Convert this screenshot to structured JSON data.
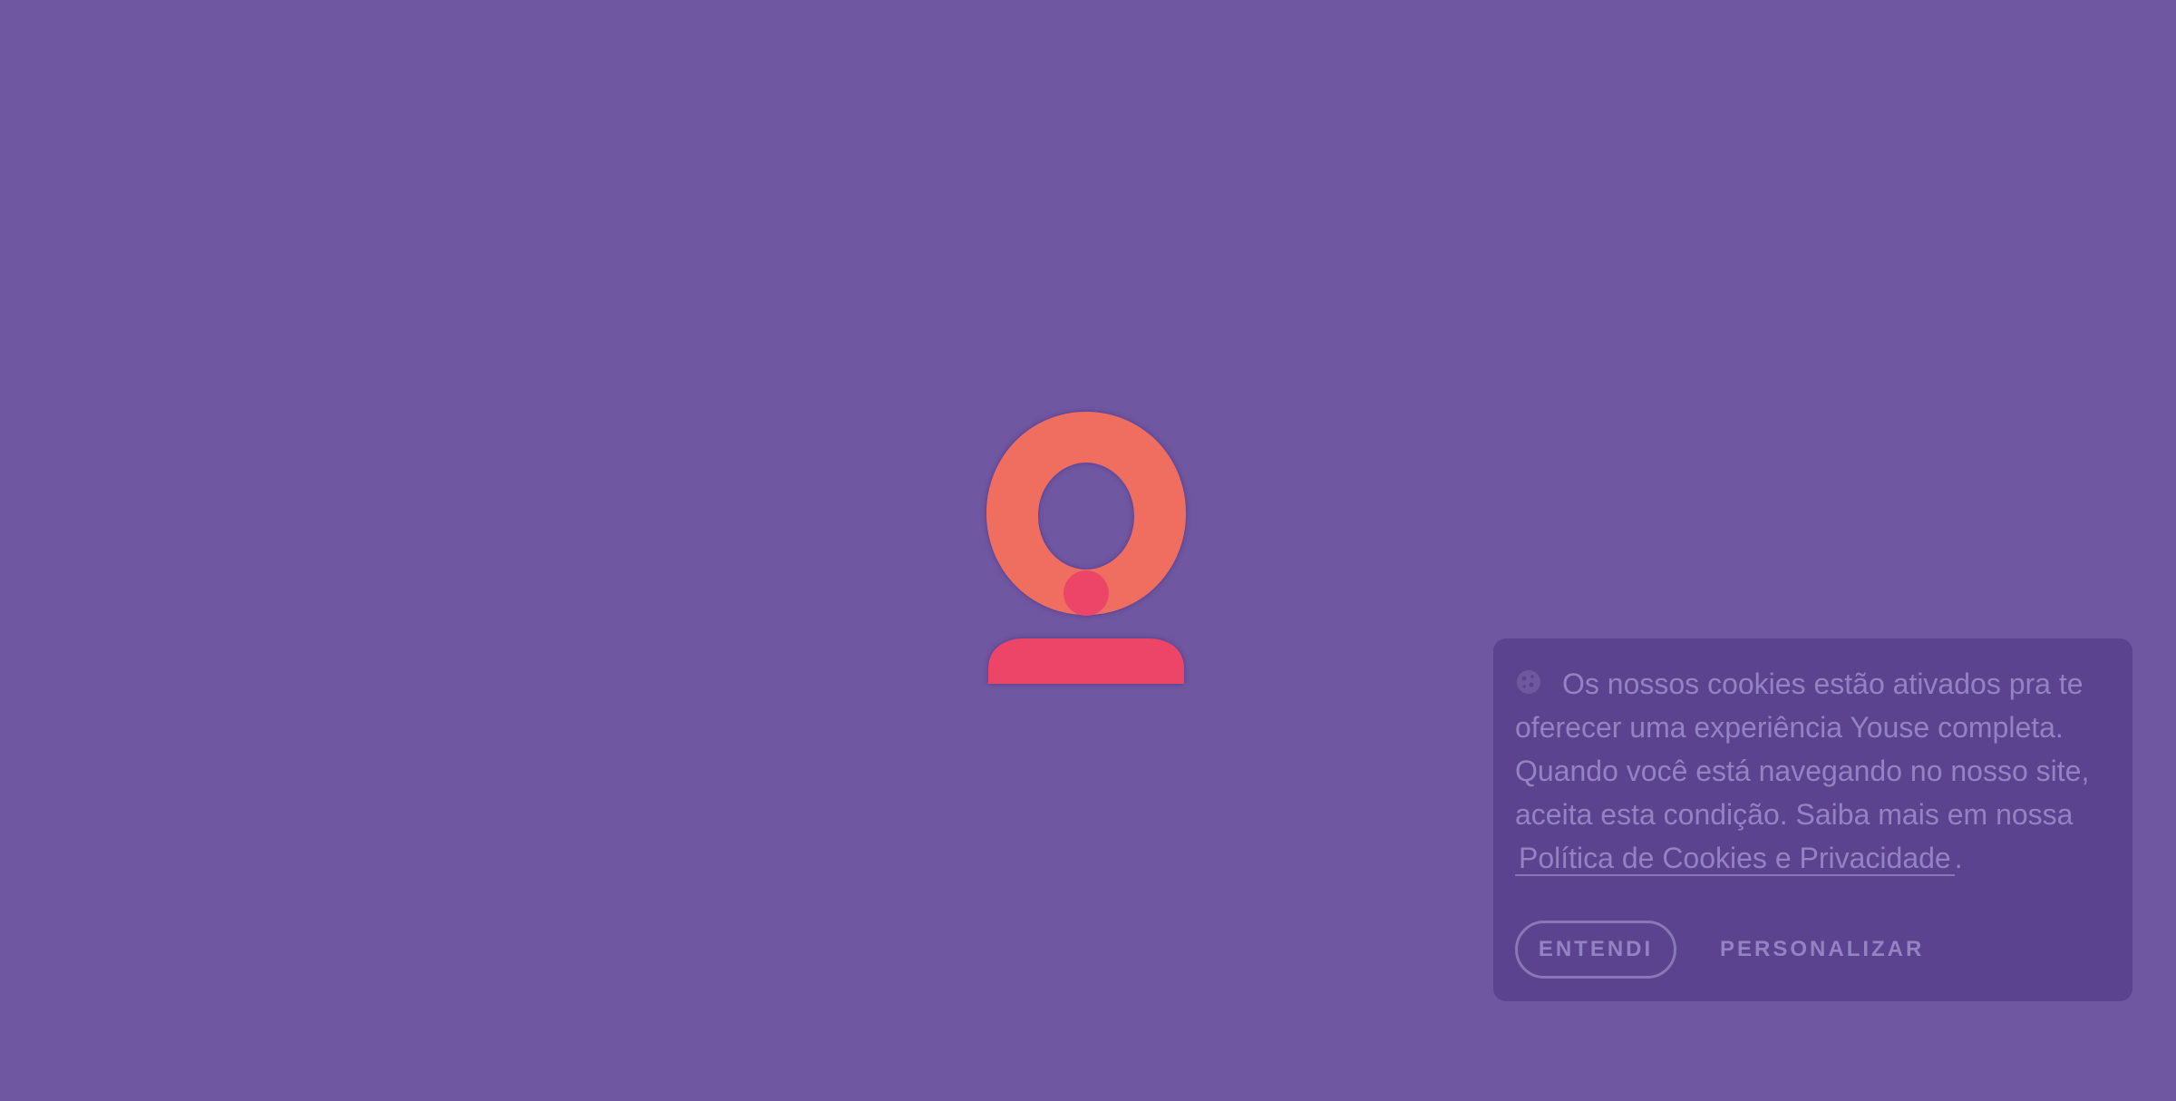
{
  "colors": {
    "background": "#6f57a1",
    "banner_background": "#5b438f",
    "banner_text": "#9582c2",
    "logo_ring": "#f06e5e",
    "logo_accent": "#ec4468"
  },
  "loader": {
    "icon": "youse-logo-icon"
  },
  "cookie_banner": {
    "icon": "cookie-icon",
    "message": "Os nossos cookies estão ativados pra te oferecer uma experiência Youse completa. Quando você está navegando no nosso site, aceita esta condição. Saiba mais em nossa",
    "policy_link": "Política de Cookies e Privacidade",
    "trailing": ".",
    "accept_label": "ENTENDI",
    "customize_label": "PERSONALIZAR"
  }
}
